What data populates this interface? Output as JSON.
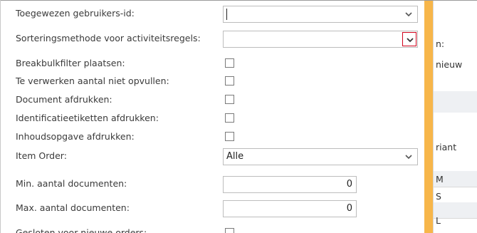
{
  "form": {
    "fields": [
      {
        "label": "Toegewezen gebruikers-id:",
        "type": "select",
        "value": ""
      },
      {
        "label": "Sorteringsmethode voor activiteitsregels:",
        "type": "select",
        "value": ""
      },
      {
        "label": "Breakbulkfilter plaatsen:",
        "type": "checkbox",
        "checked": false
      },
      {
        "label": "Te verwerken aantal niet opvullen:",
        "type": "checkbox",
        "checked": false
      },
      {
        "label": "Document afdrukken:",
        "type": "checkbox",
        "checked": false
      },
      {
        "label": "Identificatieetiketten afdrukken:",
        "type": "checkbox",
        "checked": false
      },
      {
        "label": "Inhoudsopgave afdrukken:",
        "type": "checkbox",
        "checked": false
      },
      {
        "label": "Item Order:",
        "type": "select",
        "value": "Alle"
      },
      {
        "label": "Min. aantal documenten:",
        "type": "number",
        "value": "0"
      },
      {
        "label": "Max. aantal documenten:",
        "type": "number",
        "value": "0"
      },
      {
        "label": "Gesloten voor nieuwe orders:",
        "type": "checkbox",
        "checked": false
      }
    ]
  },
  "background_window": {
    "texts": [
      "n:",
      "nieuw",
      "riant",
      "M",
      "S",
      "L"
    ]
  },
  "colors": {
    "accent_border": "#d0021b",
    "orange_bar": "#f7b64a"
  },
  "icons": {
    "dropdown": "chevron-down-icon"
  }
}
